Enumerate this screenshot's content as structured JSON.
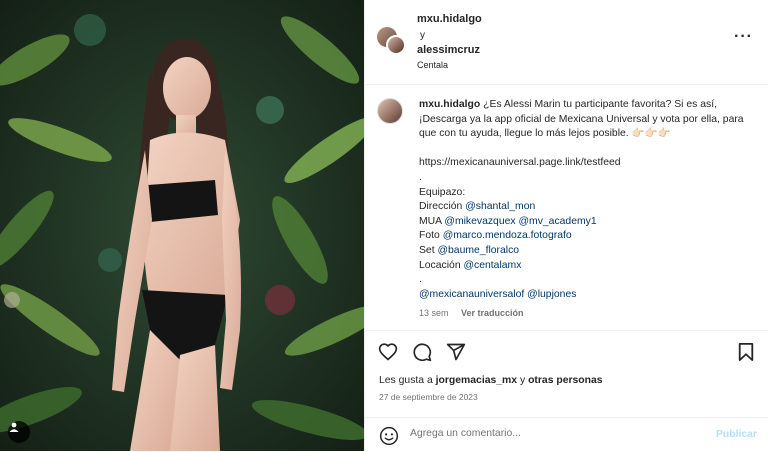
{
  "header": {
    "user1": "mxu.hidalgo",
    "conjunction": "y",
    "user2": "alessimcruz",
    "location": "Centala",
    "more_icon": "more-horizontal-icon"
  },
  "caption": {
    "username": "mxu.hidalgo",
    "text1": "¿Es Alessi Marin tu participante favorita? Si es así, ¡Descarga ya la app oficial de Mexicana Universal y vota por ella, para que con tu ayuda, llegue lo más lejos posible. 👉🏻👉🏻👉🏻",
    "url": "https://mexicanauniversal.page.link/testfeed",
    "dot1": ".",
    "team_label": "Equipazo:",
    "credits": [
      {
        "label": "Dirección ",
        "handle": "@shantal_mon"
      },
      {
        "label": "MUA ",
        "handle": "@mikevazquex",
        "handle2": "@mv_academy1"
      },
      {
        "label": "Foto ",
        "handle": "@marco.mendoza.fotografo"
      },
      {
        "label": "Set ",
        "handle": "@baume_floralco"
      },
      {
        "label": "Locación ",
        "handle": "@centalamx"
      }
    ],
    "dot2": ".",
    "mention1": "@mexicanauniversalof",
    "mention2": "@lupjones",
    "time": "13 sem",
    "translate": "Ver traducción"
  },
  "actions": {
    "likes_prefix": "Les gusta a ",
    "likes_user": "jorgemacias_mx",
    "likes_mid": " y ",
    "likes_others": "otras personas",
    "date": "27 de septiembre de 2023"
  },
  "comment": {
    "placeholder": "Agrega un comentario...",
    "publish": "Publicar"
  },
  "colors": {
    "link": "#00376b",
    "publish_disabled": "#b2dffc",
    "muted": "#737373"
  }
}
